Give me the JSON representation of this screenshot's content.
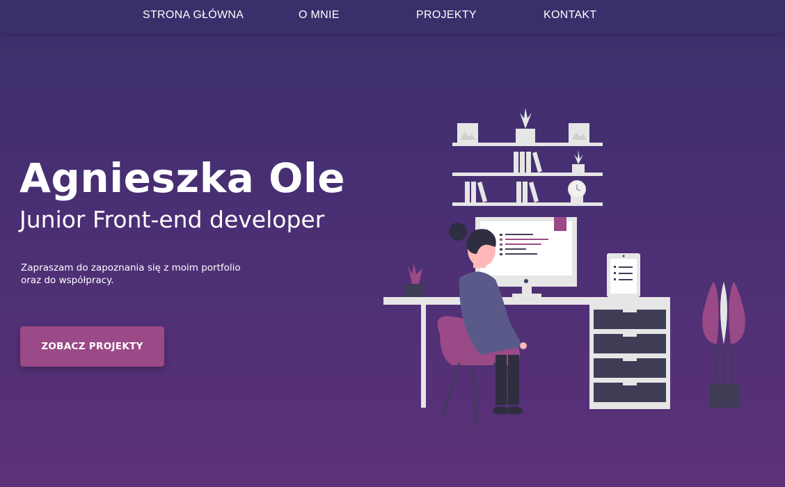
{
  "nav": {
    "items": [
      {
        "label": "STRONA GŁÓWNA"
      },
      {
        "label": "O MNIE"
      },
      {
        "label": "PROJEKTY"
      },
      {
        "label": "KONTAKT"
      }
    ]
  },
  "hero": {
    "name": "Agnieszka Ole",
    "role": "Junior Front-end developer",
    "intro_line1": "Zapraszam do zapoznania się z moim portfolio",
    "intro_line2": "oraz do współpracy.",
    "cta_label": "ZOBACZ PROJEKTY"
  },
  "colors": {
    "nav_bg": "#38306b",
    "accent": "#9a4a86",
    "furniture": "#e6e6e6",
    "dark": "#3f3d56"
  },
  "illustration": {
    "icon": "woman-at-desk-illustration"
  }
}
